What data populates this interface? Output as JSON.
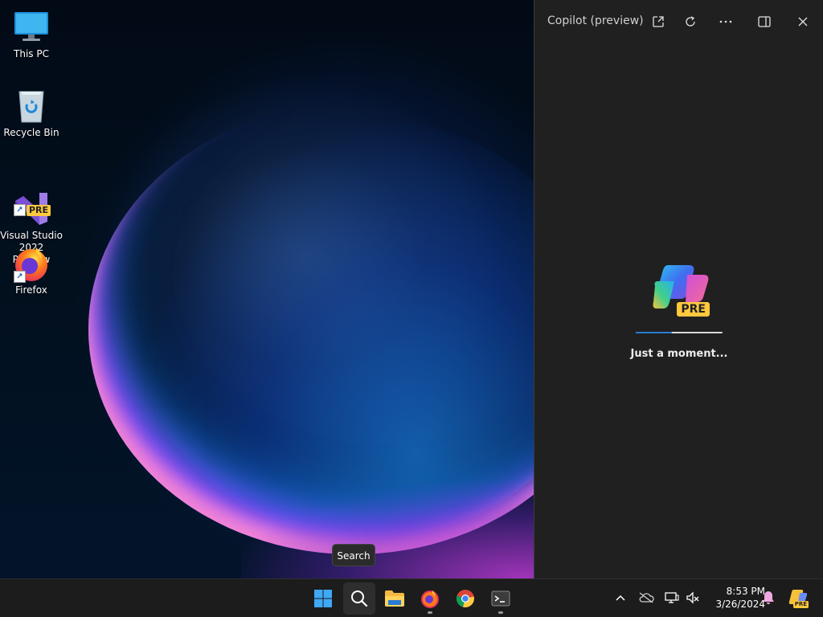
{
  "desktop": {
    "icons": [
      {
        "label": "This PC",
        "icon": "monitor-icon"
      },
      {
        "label": "Recycle Bin",
        "icon": "recycle-bin-icon"
      },
      {
        "label": "Visual Studio\n2022 Preview",
        "icon": "visual-studio-icon",
        "badge": "PRE"
      },
      {
        "label": "Firefox",
        "icon": "firefox-icon"
      }
    ]
  },
  "copilot": {
    "title": "Copilot (preview)",
    "header_buttons": [
      "open-external-icon",
      "refresh-icon",
      "more-icon",
      "dock-panel-icon",
      "close-icon"
    ],
    "logo_badge": "PRE",
    "loading_text": "Just a moment...",
    "progress": 0.42
  },
  "tooltip": {
    "text": "Search"
  },
  "taskbar": {
    "apps": [
      {
        "name": "start",
        "icon": "windows-logo-icon"
      },
      {
        "name": "search",
        "icon": "search-icon"
      },
      {
        "name": "file-explorer",
        "icon": "folder-icon"
      },
      {
        "name": "firefox",
        "icon": "firefox-icon"
      },
      {
        "name": "chrome",
        "icon": "chrome-icon"
      },
      {
        "name": "terminal",
        "icon": "terminal-icon"
      }
    ],
    "tray_icons": [
      "chevron-up-icon",
      "onedrive-offline-icon",
      "network-icon",
      "volume-muted-icon"
    ],
    "clock": {
      "time": "8:53 PM",
      "date": "3/26/2024"
    },
    "notification_icon": "bell-icon",
    "copilot_badge": "PRE"
  },
  "colors": {
    "accent": "#2a7bd5",
    "panel_bg": "#202020",
    "taskbar_bg": "#1c1c1c",
    "badge": "#ffc83d"
  }
}
